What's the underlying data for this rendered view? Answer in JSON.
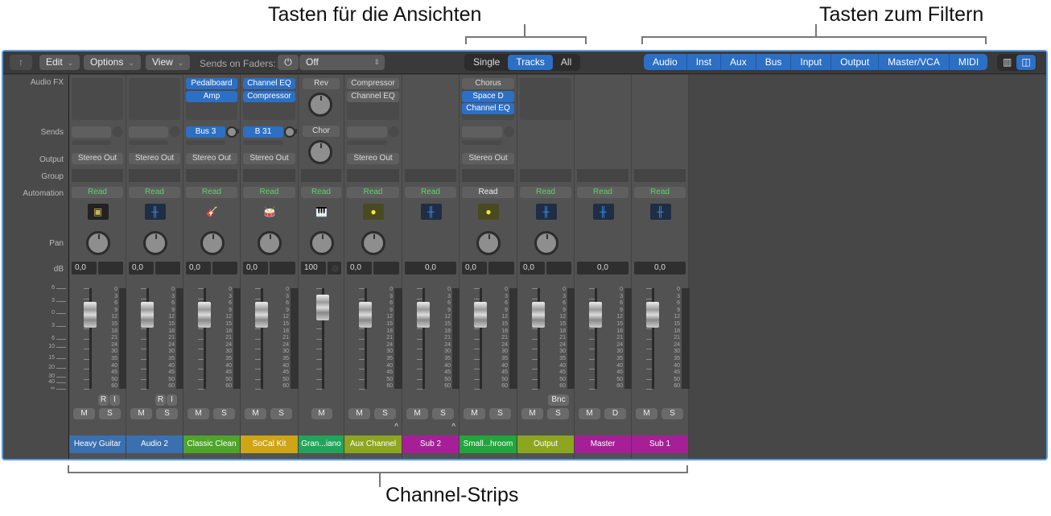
{
  "callouts": {
    "views": "Tasten für die Ansichten",
    "filters": "Tasten zum Filtern",
    "strips": "Channel-Strips"
  },
  "toolbar": {
    "back_icon": "arrow-up-icon",
    "edit": "Edit",
    "options": "Options",
    "view": "View",
    "sends_label": "Sends on Faders:",
    "sends_value": "Off",
    "view_modes": [
      "Single",
      "Tracks",
      "All"
    ],
    "view_selected": "Tracks",
    "filters": [
      "Audio",
      "Inst",
      "Aux",
      "Bus",
      "Input",
      "Output",
      "Master/VCA",
      "MIDI"
    ],
    "layout_icons": [
      "narrow-layout-icon",
      "wide-layout-icon"
    ]
  },
  "row_labels": {
    "fx": "Audio FX",
    "sends": "Sends",
    "output": "Output",
    "group": "Group",
    "automation": "Automation",
    "pan": "Pan",
    "db": "dB"
  },
  "scale": [
    "6",
    "3",
    "0",
    "3",
    "6",
    "10",
    "15",
    "20",
    "30",
    "40",
    "∞"
  ],
  "meter_scale": [
    "0",
    "3",
    "6",
    "9",
    "12",
    "15",
    "18",
    "21",
    "24",
    "30",
    "35",
    "40",
    "45",
    "50",
    "60"
  ],
  "colors": {
    "accent": "#2c6fc4",
    "automation": "#5fd06a"
  },
  "strips": [
    {
      "name": "Heavy Guitar",
      "color": "#3a6fb0",
      "fx": [],
      "send": null,
      "output": "Stereo Out",
      "auto": "Read",
      "icon": "amp-icon",
      "vol": "0,0",
      "pk": "",
      "ri": true,
      "btns": [
        "M",
        "S"
      ]
    },
    {
      "name": "Audio 2",
      "color": "#3a6fb0",
      "fx": [],
      "send": null,
      "output": "Stereo Out",
      "auto": "Read",
      "icon": "waveform-icon",
      "vol": "0,0",
      "pk": "",
      "ri": true,
      "btns": [
        "M",
        "S"
      ]
    },
    {
      "name": "Classic Clean",
      "color": "#4ea52a",
      "fx": [
        {
          "n": "Pedalboard",
          "b": 1
        },
        {
          "n": "Amp",
          "b": 1
        }
      ],
      "send": "Bus 3",
      "output": "Stereo Out",
      "auto": "Read",
      "icon": "guitar-icon",
      "vol": "0,0",
      "pk": "",
      "btns": [
        "M",
        "S"
      ]
    },
    {
      "name": "SoCal Kit",
      "color": "#cfa516",
      "fx": [
        {
          "n": "Channel EQ",
          "b": 1
        },
        {
          "n": "Compressor",
          "b": 1
        }
      ],
      "send": "B 31",
      "output": "Stereo Out",
      "auto": "Read",
      "icon": "drums-icon",
      "vol": "0,0",
      "pk": "",
      "btns": [
        "M",
        "S"
      ]
    },
    {
      "name": "Gran...iano",
      "color": "#21a55a",
      "fx": [
        {
          "n": "Rev",
          "b": 0
        }
      ],
      "send2": "Chor",
      "output": null,
      "auto": "Read",
      "icon": "piano-icon",
      "vol": "100",
      "pk": "",
      "btns": [
        "M"
      ]
    },
    {
      "name": "Aux Channel",
      "color": "#8ca620",
      "fx": [
        {
          "n": "Compressor",
          "b": 0
        },
        {
          "n": "Channel EQ",
          "b": 0
        }
      ],
      "send": null,
      "output": "Stereo Out",
      "auto": "Read",
      "icon": "knob-icon",
      "vol": "0,0",
      "pk": "",
      "btns": [
        "M",
        "S"
      ],
      "caret": true
    },
    {
      "name": "Sub 2",
      "color": "#a61f97",
      "fx": null,
      "send": null,
      "output": null,
      "auto": "Read",
      "icon": "waveform-icon",
      "vol": "0,0",
      "btns": [
        "M",
        "S"
      ],
      "caret": true
    },
    {
      "name": "Small...hroom",
      "color": "#21a53c",
      "fx": [
        {
          "n": "Chorus",
          "b": 0
        },
        {
          "n": "Space D",
          "b": 1
        },
        {
          "n": "Channel EQ",
          "b": 1
        }
      ],
      "send": null,
      "output": "Stereo Out",
      "auto": "Read",
      "autoWhite": true,
      "icon": "knob-icon",
      "vol": "0,0",
      "pk": "",
      "btns": [
        "M",
        "S"
      ]
    },
    {
      "name": "Output",
      "color": "#8ca620",
      "fx": [],
      "nosend": true,
      "output": null,
      "auto": "Read",
      "icon": "waveform-icon",
      "vol": "0,0",
      "pk": "",
      "bnc": "Bnc",
      "btns": [
        "M",
        "S"
      ]
    },
    {
      "name": "Master",
      "color": "#a61f97",
      "fx": null,
      "output": null,
      "auto": "Read",
      "icon": "waveform-icon",
      "vol": "0,0",
      "btns": [
        "M",
        "D"
      ],
      "nopan": true
    },
    {
      "name": "Sub 1",
      "color": "#a61f97",
      "fx": null,
      "output": null,
      "auto": "Read",
      "icon": "waveform-icon",
      "vol": "0,0",
      "btns": [
        "M",
        "S"
      ],
      "nopan": true
    }
  ]
}
